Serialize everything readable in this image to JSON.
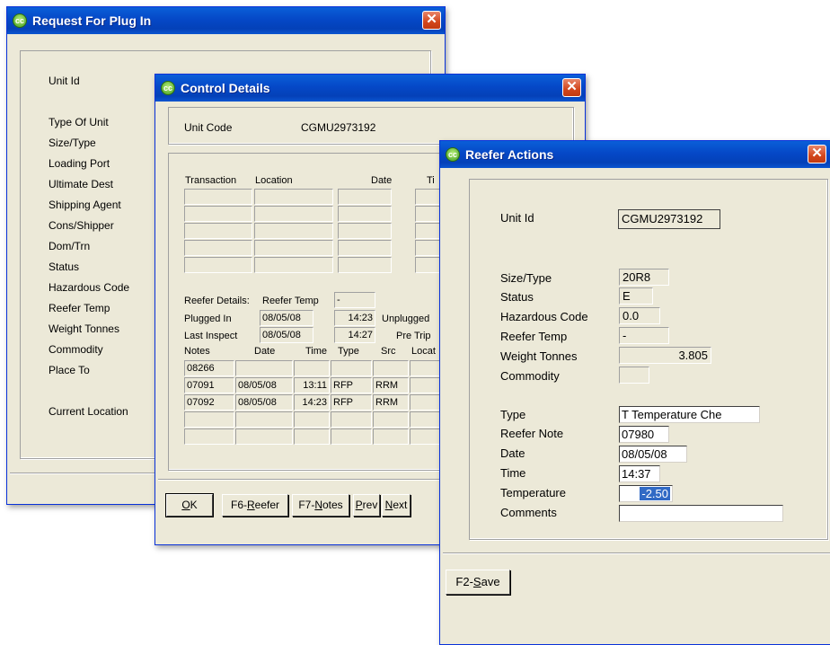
{
  "request_window": {
    "title": "Request For Plug In",
    "labels": [
      "Unit Id",
      "Type Of Unit",
      "Size/Type",
      "Loading Port",
      "Ultimate Dest",
      "Shipping Agent",
      "Cons/Shipper",
      "Dom/Trn",
      "Status",
      "Hazardous Code",
      "Reefer Temp",
      "Weight Tonnes",
      "Commodity",
      "Place To",
      "Current Location"
    ]
  },
  "control_window": {
    "title": "Control Details",
    "unit_code_label": "Unit Code",
    "unit_code_value": "CGMU2973192",
    "transactions_headers": [
      "Transaction",
      "Location",
      "Date",
      "Ti"
    ],
    "reefer_details_label": "Reefer Details:",
    "reefer_temp_label": "Reefer Temp",
    "reefer_temp_value": "-",
    "plugged_in_label": "Plugged In",
    "plugged_in_date": "08/05/08",
    "plugged_in_time": "14:23",
    "unplugged_label": "Unplugged",
    "last_inspect_label": "Last Inspect",
    "last_inspect_date": "08/05/08",
    "last_inspect_time": "14:27",
    "pre_trip_label": "Pre Trip",
    "notes_headers": [
      "Notes",
      "Date",
      "Time",
      "Type",
      "Src",
      "Locat"
    ],
    "notes_rows": [
      [
        "08266",
        "",
        "",
        "",
        "",
        ""
      ],
      [
        "07091",
        "08/05/08",
        "13:11",
        "RFP",
        "RRM",
        ""
      ],
      [
        "07092",
        "08/05/08",
        "14:23",
        "RFP",
        "RRM",
        ""
      ],
      [
        "",
        "",
        "",
        "",
        "",
        ""
      ],
      [
        "",
        "",
        "",
        "",
        "",
        ""
      ]
    ],
    "buttons": {
      "ok": {
        "label": "OK",
        "key": "O",
        "rest": "K"
      },
      "reefer": {
        "prefix": "F6-",
        "key": "R",
        "rest": "eefer"
      },
      "notes": {
        "prefix": "F7-",
        "key": "N",
        "rest": "otes"
      },
      "prev": {
        "key": "P",
        "rest": "rev"
      },
      "next": {
        "prefix": "",
        "key": "N",
        "rest": "ext"
      }
    }
  },
  "reefer_window": {
    "title": "Reefer Actions",
    "unit_id_label": "Unit Id",
    "unit_id_value": "CGMU2973192",
    "size_type_label": "Size/Type",
    "size_type_value": "20R8",
    "status_label": "Status",
    "status_value": "E",
    "hazardous_label": "Hazardous Code",
    "hazardous_value": "0.0",
    "reefer_temp_label": "Reefer Temp",
    "reefer_temp_value": "-",
    "weight_label": "Weight Tonnes",
    "weight_value": "3.805",
    "commodity_label": "Commodity",
    "commodity_value": "",
    "type_label": "Type",
    "type_value": "T Temperature Che",
    "reefer_note_label": "Reefer Note",
    "reefer_note_value": "07980",
    "date_label": "Date",
    "date_value": "08/05/08",
    "time_label": "Time",
    "time_value": "14:37",
    "temperature_label": "Temperature",
    "temperature_value": "-2.50",
    "comments_label": "Comments",
    "comments_value": "",
    "save_button": {
      "prefix": "F2-",
      "key": "S",
      "rest": "ave"
    }
  },
  "colors": {
    "title_bar": "#0548c7",
    "window_bg": "#ece9d8",
    "close_button": "#d2461c",
    "selection": "#316ac5"
  }
}
